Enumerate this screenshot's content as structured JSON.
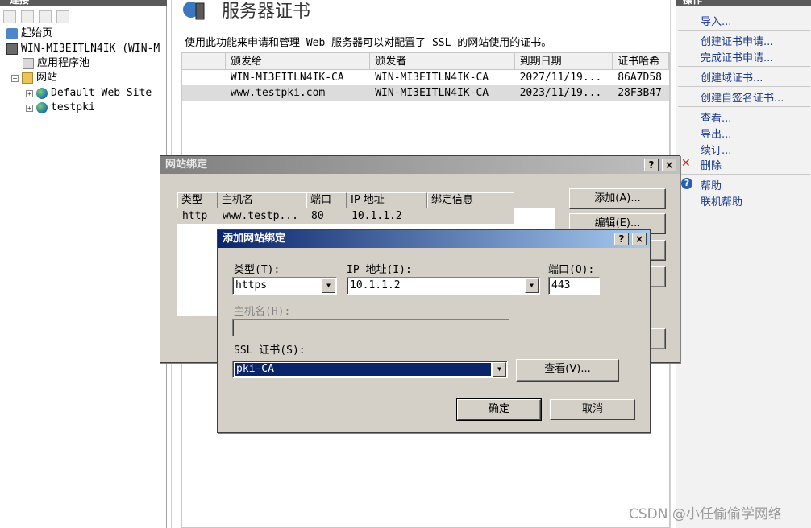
{
  "left": {
    "header": "连接",
    "tree": [
      {
        "label": "起始页"
      },
      {
        "label": "WIN-MI3EITLN4IK (WIN-M"
      },
      {
        "label": "应用程序池"
      },
      {
        "label": "网站"
      },
      {
        "label": "Default Web Site"
      },
      {
        "label": "testpki"
      }
    ]
  },
  "main": {
    "title": "服务器证书",
    "description": "使用此功能来申请和管理 Web 服务器可以对配置了 SSL 的网站使用的证书。",
    "columns": [
      "颁发给",
      "颁发者",
      "到期日期",
      "证书哈希"
    ],
    "rows": [
      {
        "issued_to": "WIN-MI3EITLN4IK-CA",
        "issued_by": "WIN-MI3EITLN4IK-CA",
        "expires": "2027/11/19...",
        "hash": "86A7D58"
      },
      {
        "issued_to": "www.testpki.com",
        "issued_by": "WIN-MI3EITLN4IK-CA",
        "expires": "2023/11/19...",
        "hash": "28F3B47"
      }
    ]
  },
  "right": {
    "header": "操作",
    "actions": [
      "导入...",
      "创建证书申请...",
      "完成证书申请...",
      "创建域证书...",
      "创建自签名证书...",
      "查看...",
      "导出...",
      "续订...",
      "删除",
      "帮助",
      "联机帮助"
    ]
  },
  "bindings_dialog": {
    "title": "网站绑定",
    "help_btn": "?",
    "close_btn": "×",
    "columns": [
      "类型",
      "主机名",
      "端口",
      "IP 地址",
      "绑定信息"
    ],
    "rows": [
      {
        "type": "http",
        "host": "www.testp...",
        "port": "80",
        "ip": "10.1.1.2",
        "info": ""
      }
    ],
    "add_btn": "添加(A)...",
    "edit_btn": "编辑(E)..."
  },
  "add_dialog": {
    "title": "添加网站绑定",
    "help_btn": "?",
    "close_btn": "×",
    "type_label": "类型(T):",
    "type_value": "https",
    "ip_label": "IP 地址(I):",
    "ip_value": "10.1.1.2",
    "port_label": "端口(O):",
    "port_value": "443",
    "host_label": "主机名(H):",
    "host_value": "",
    "ssl_label": "SSL 证书(S):",
    "ssl_value": "pki-CA",
    "view_btn": "查看(V)...",
    "ok_btn": "确定",
    "cancel_btn": "取消"
  },
  "watermark": "CSDN @小任偷偷学网络"
}
